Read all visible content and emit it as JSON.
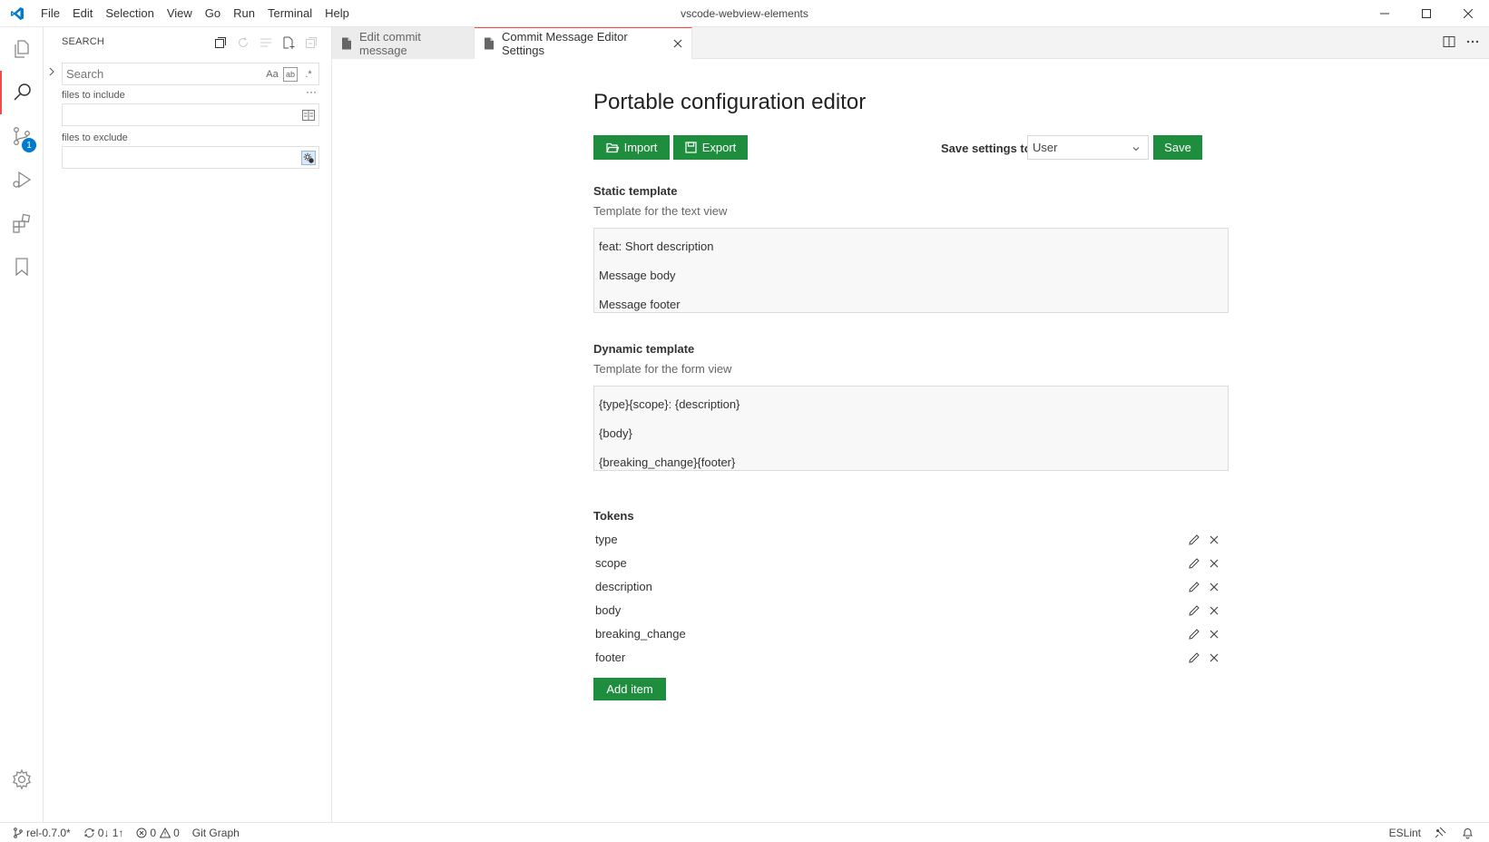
{
  "window": {
    "title": "vscode-webview-elements"
  },
  "menu": [
    "File",
    "Edit",
    "Selection",
    "View",
    "Go",
    "Run",
    "Terminal",
    "Help"
  ],
  "activity": {
    "source_control_badge": "1"
  },
  "sidebar": {
    "title": "SEARCH",
    "search_placeholder": "Search",
    "match_case": "Aa",
    "whole_word": "ab",
    "regex": ".*",
    "more": "···",
    "include_label": "files to include",
    "exclude_label": "files to exclude"
  },
  "tabs": [
    {
      "label": "Edit commit message",
      "active": false
    },
    {
      "label": "Commit Message Editor Settings",
      "active": true
    }
  ],
  "editor": {
    "title": "Portable configuration editor",
    "import_label": "Import",
    "export_label": "Export",
    "save_to_label": "Save settings to:",
    "save_to_value": "User",
    "save_label": "Save",
    "static_template": {
      "title": "Static template",
      "subtitle": "Template for the text view",
      "lines": [
        "feat: Short description",
        "Message body",
        "Message footer"
      ]
    },
    "dynamic_template": {
      "title": "Dynamic template",
      "subtitle": "Template for the form view",
      "lines": [
        "{type}{scope}: {description}",
        "{body}",
        "{breaking_change}{footer}"
      ]
    },
    "tokens": {
      "title": "Tokens",
      "items": [
        "type",
        "scope",
        "description",
        "body",
        "breaking_change",
        "footer"
      ],
      "add_label": "Add item"
    }
  },
  "statusbar": {
    "branch": "rel-0.7.0*",
    "sync": "0↓ 1↑",
    "errors": "0",
    "warnings": "0",
    "git_graph": "Git Graph",
    "eslint": "ESLint"
  },
  "colors": {
    "accent_green": "#1e8e3e",
    "active_tab_border": "#f14c4c",
    "vscode_blue": "#007acc"
  }
}
